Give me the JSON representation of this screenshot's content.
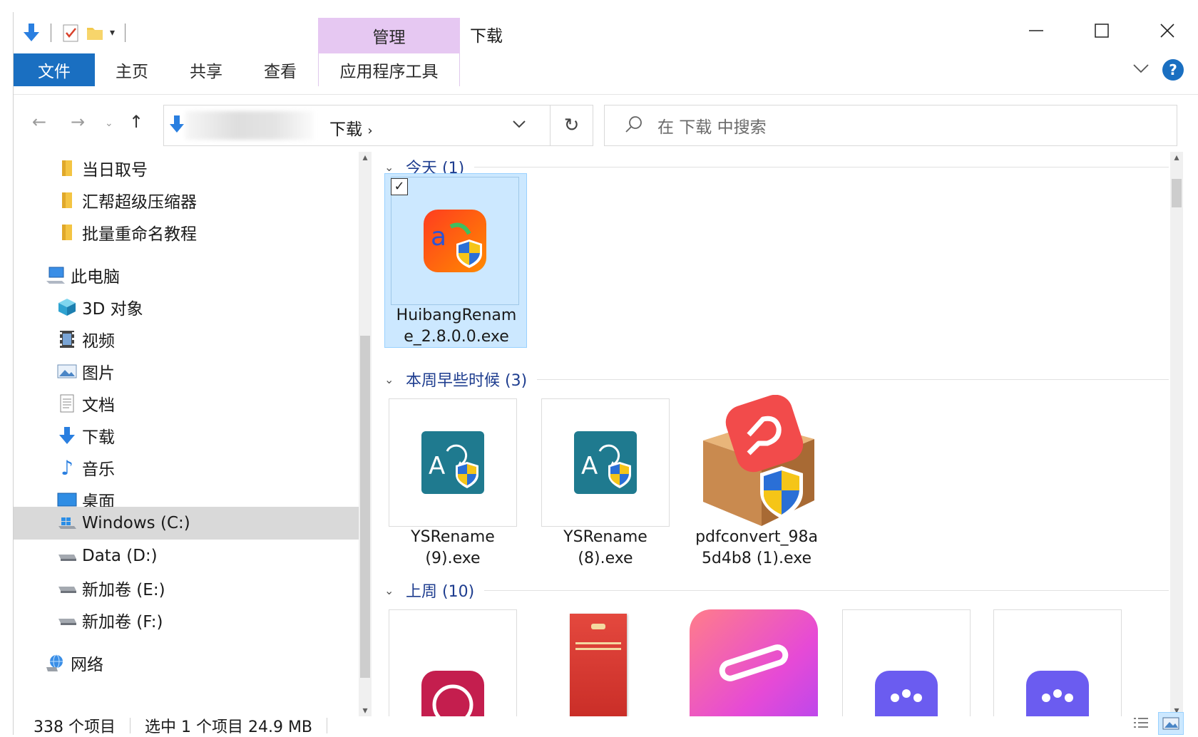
{
  "window": {
    "title": "下载",
    "manage_tab": "管理"
  },
  "ribbon": {
    "tabs": [
      "文件",
      "主页",
      "共享",
      "查看",
      "应用程序工具"
    ]
  },
  "address": {
    "current_folder": "下载",
    "search_placeholder": "在 下载 中搜索"
  },
  "nav": {
    "items": [
      {
        "label": "当日取号",
        "icon": "folder-icon"
      },
      {
        "label": "汇帮超级压缩器",
        "icon": "folder-icon"
      },
      {
        "label": "批量重命名教程",
        "icon": "folder-icon"
      },
      {
        "label": "此电脑",
        "icon": "computer-icon"
      },
      {
        "label": "3D 对象",
        "icon": "cube-3d-icon"
      },
      {
        "label": "视频",
        "icon": "video-icon"
      },
      {
        "label": "图片",
        "icon": "pictures-icon"
      },
      {
        "label": "文档",
        "icon": "documents-icon"
      },
      {
        "label": "下载",
        "icon": "download-icon"
      },
      {
        "label": "音乐",
        "icon": "music-icon"
      },
      {
        "label": "桌面",
        "icon": "desktop-icon"
      },
      {
        "label": "Windows (C:)",
        "icon": "windows-drive-icon"
      },
      {
        "label": "Data (D:)",
        "icon": "drive-icon"
      },
      {
        "label": "新加卷 (E:)",
        "icon": "drive-icon"
      },
      {
        "label": "新加卷 (F:)",
        "icon": "drive-icon"
      },
      {
        "label": "网络",
        "icon": "network-icon"
      }
    ]
  },
  "groups": [
    {
      "title": "今天 (1)",
      "files": [
        {
          "name_line1": "HuibangRenam",
          "name_line2": "e_2.8.0.0.exe",
          "selected": true
        }
      ]
    },
    {
      "title": "本周早些时候 (3)",
      "files": [
        {
          "name_line1": "YSRename",
          "name_line2": "(9).exe"
        },
        {
          "name_line1": "YSRename",
          "name_line2": "(8).exe"
        },
        {
          "name_line1": "pdfconvert_98a",
          "name_line2": "5d4b8 (1).exe"
        }
      ]
    },
    {
      "title": "上周 (10)",
      "files": []
    }
  ],
  "status": {
    "count": "338 个项目",
    "selection": "选中 1 个项目  24.9 MB"
  },
  "colors": {
    "accent": "#1a6fc1",
    "manage_tab": "#e6c8f2",
    "group_header": "#1e3d8f",
    "selection": "#cce8ff"
  }
}
